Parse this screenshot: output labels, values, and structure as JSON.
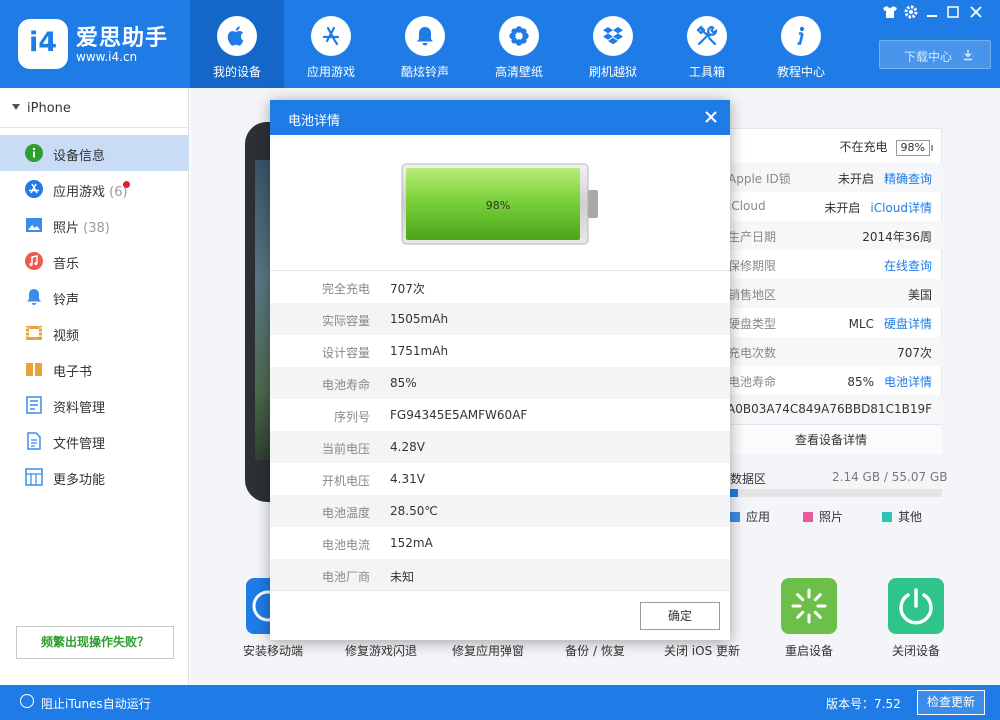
{
  "app": {
    "logo_text": "i4",
    "name": "爱思助手",
    "url": "www.i4.cn"
  },
  "nav": [
    {
      "label": "我的设备",
      "icon": "apple-icon"
    },
    {
      "label": "应用游戏",
      "icon": "app-store-icon"
    },
    {
      "label": "酷炫铃声",
      "icon": "bell-icon"
    },
    {
      "label": "高清壁纸",
      "icon": "flower-icon"
    },
    {
      "label": "刷机越狱",
      "icon": "dropbox-icon"
    },
    {
      "label": "工具箱",
      "icon": "tools-icon"
    },
    {
      "label": "教程中心",
      "icon": "info-icon"
    }
  ],
  "download_center": "下载中心",
  "sidebar": {
    "device": "iPhone",
    "items": [
      {
        "label": "设备信息",
        "count": "",
        "icon": "info-circle-icon",
        "color": "#2e9e2e"
      },
      {
        "label": "应用游戏",
        "count": "(6)",
        "icon": "app-store-icon",
        "color": "#1f7ce6"
      },
      {
        "label": "照片",
        "count": "(38)",
        "icon": "photo-icon",
        "color": "#3a8de9"
      },
      {
        "label": "音乐",
        "count": "",
        "icon": "music-icon",
        "color": "#f05a4a"
      },
      {
        "label": "铃声",
        "count": "",
        "icon": "bell-icon",
        "color": "#3a8de9"
      },
      {
        "label": "视频",
        "count": "",
        "icon": "video-icon",
        "color": "#e8a23a"
      },
      {
        "label": "电子书",
        "count": "",
        "icon": "book-icon",
        "color": "#e8a23a"
      },
      {
        "label": "资料管理",
        "count": "",
        "icon": "contacts-icon",
        "color": "#3a8de9"
      },
      {
        "label": "文件管理",
        "count": "",
        "icon": "file-icon",
        "color": "#3a8de9"
      },
      {
        "label": "更多功能",
        "count": "",
        "icon": "grid-icon",
        "color": "#3a8de9"
      }
    ],
    "fail_button": "频繁出现操作失败？"
  },
  "info": {
    "charging": "不在充电",
    "battery_pct": "98%",
    "rows": [
      {
        "key": "Apple ID锁",
        "value": "未开启",
        "link": "精确查询"
      },
      {
        "key": "iCloud",
        "value": "未开启",
        "link": "iCloud详情"
      },
      {
        "key": "生产日期",
        "value": "2014年36周",
        "link": ""
      },
      {
        "key": "保修期限",
        "value": "",
        "link": "在线查询"
      },
      {
        "key": "销售地区",
        "value": "美国",
        "link": ""
      },
      {
        "key": "硬盘类型",
        "value": "MLC",
        "link": "硬盘详情"
      },
      {
        "key": "充电次数",
        "value": "707次",
        "link": ""
      },
      {
        "key": "电池寿命",
        "value": "85%",
        "link": "电池详情"
      }
    ],
    "serial": "CA0B03A74C849A76BBD81C1B19F",
    "detail_button": "查看设备详情"
  },
  "storage": {
    "label": "数据区",
    "value": "2.14 GB / 55.07 GB",
    "used_fraction": 0.039,
    "legend": [
      {
        "label": "应用",
        "color": "#3a8de9"
      },
      {
        "label": "照片",
        "color": "#e85a9a"
      },
      {
        "label": "其他",
        "color": "#2ec4b6"
      }
    ]
  },
  "tools": [
    {
      "label": "安装移动端",
      "color": "#1f7ce6"
    },
    {
      "label": "修复游戏闪退",
      "color": ""
    },
    {
      "label": "修复应用弹窗",
      "color": ""
    },
    {
      "label": "备份 / 恢复",
      "color": ""
    },
    {
      "label": "关闭 iOS 更新",
      "color": ""
    },
    {
      "label": "重启设备",
      "color": "#6cc04a"
    },
    {
      "label": "关闭设备",
      "color": "#2ec48a"
    }
  ],
  "modal": {
    "title": "电池详情",
    "battery_level": 0.98,
    "battery_label": "98%",
    "rows": [
      {
        "key": "完全充电",
        "value": "707次"
      },
      {
        "key": "实际容量",
        "value": "1505mAh"
      },
      {
        "key": "设计容量",
        "value": "1751mAh"
      },
      {
        "key": "电池寿命",
        "value": "85%"
      },
      {
        "key": "序列号",
        "value": "FG94345E5AMFW60AF"
      },
      {
        "key": "当前电压",
        "value": "4.28V"
      },
      {
        "key": "开机电压",
        "value": "4.31V"
      },
      {
        "key": "电池温度",
        "value": "28.50℃"
      },
      {
        "key": "电池电流",
        "value": "152mA"
      },
      {
        "key": "电池厂商",
        "value": "未知"
      }
    ],
    "ok_button": "确定"
  },
  "status": {
    "itunes": "阻止iTunes自动运行",
    "version": "版本号：7.52",
    "update_button": "检查更新"
  }
}
